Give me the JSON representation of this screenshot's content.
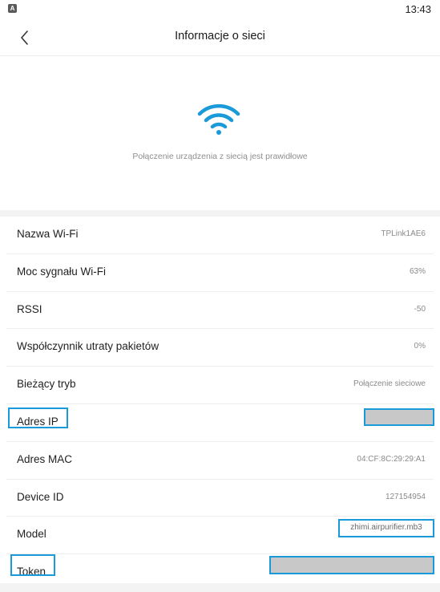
{
  "status_bar": {
    "app_icon_letter": "A",
    "time": "13:43"
  },
  "header": {
    "title": "Informacje o sieci",
    "back_icon": "chevron-left-icon"
  },
  "hero": {
    "icon": "wifi-icon",
    "icon_color": "#1a9ad9",
    "message": "Połączenie urządzenia z siecią jest prawidłowe"
  },
  "rows": [
    {
      "label": "Nazwa Wi-Fi",
      "value": "TPLink1AE6"
    },
    {
      "label": "Moc sygnału Wi-Fi",
      "value": "63%"
    },
    {
      "label": "RSSI",
      "value": "-50"
    },
    {
      "label": "Współczynnik utraty pakietów",
      "value": "0%"
    },
    {
      "label": "Bieżący tryb",
      "value": "Połączenie sieciowe"
    },
    {
      "label": "Adres IP",
      "value": ""
    },
    {
      "label": "Adres MAC",
      "value": "04:CF:8C:29:29:A1"
    },
    {
      "label": "Device ID",
      "value": "127154954"
    },
    {
      "label": "Model",
      "value": "zhimi.airpurifier.mb3"
    },
    {
      "label": "Token",
      "value": ""
    }
  ],
  "colors": {
    "highlight": "#1a9ad9",
    "redaction": "#c8c8c8"
  }
}
